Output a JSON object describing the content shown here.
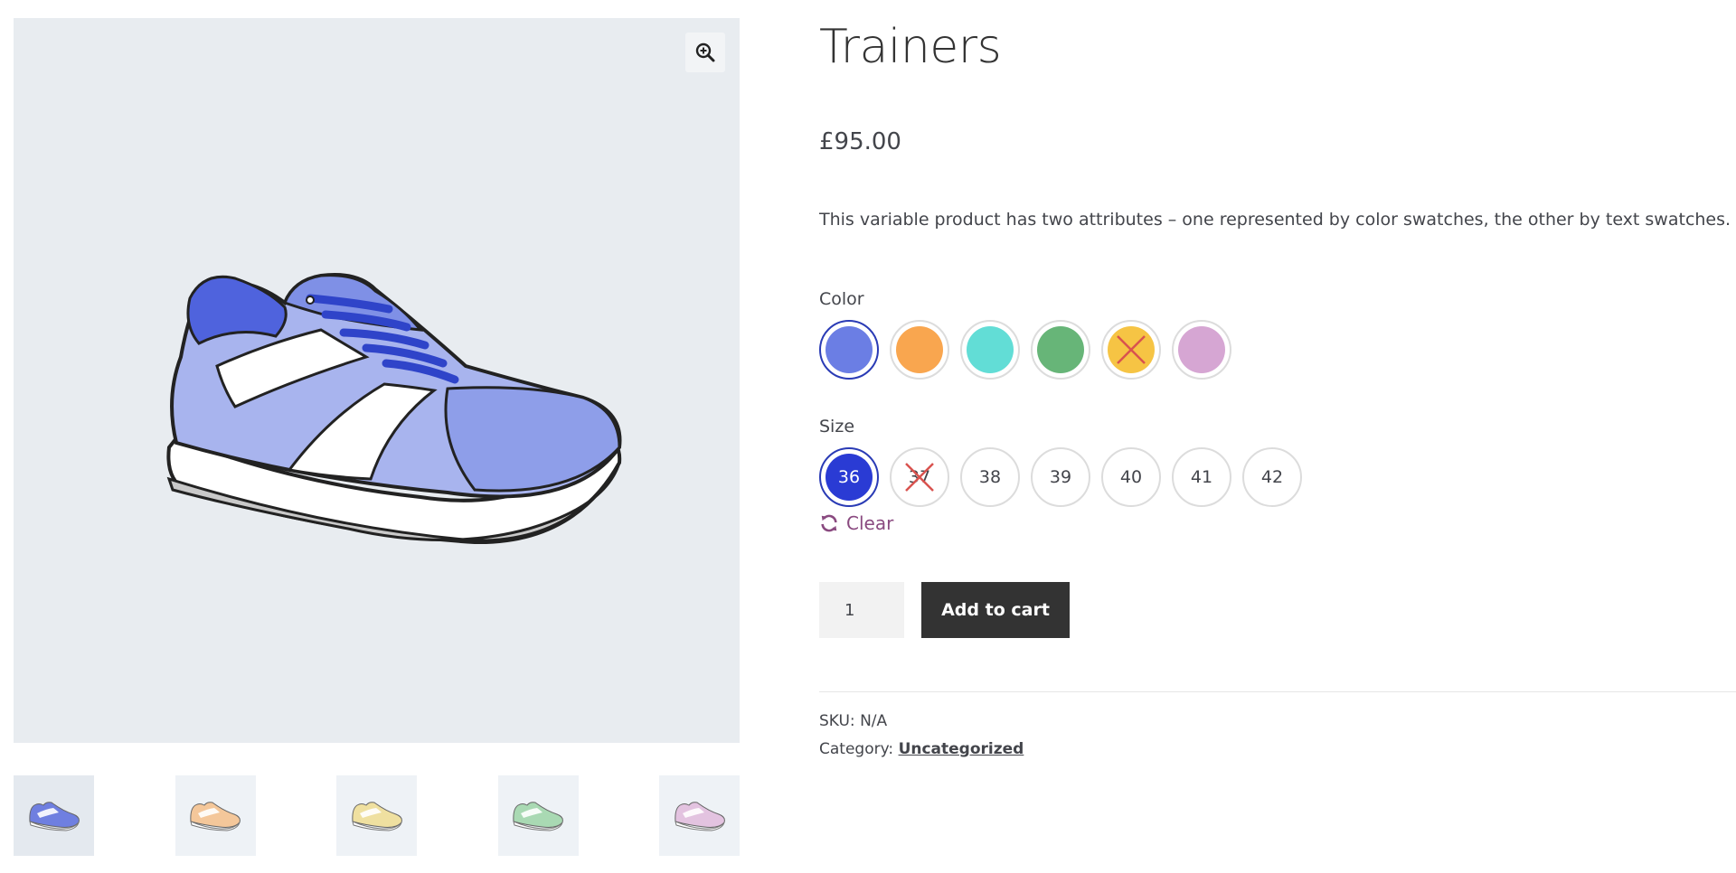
{
  "gallery": {
    "zoom_icon": "zoom-in-icon",
    "thumbnails": [
      {
        "color": "#6f7fe0",
        "active": true
      },
      {
        "color": "#f4c79a",
        "active": false
      },
      {
        "color": "#efe0a0",
        "active": false
      },
      {
        "color": "#a9d9b3",
        "active": false
      },
      {
        "color": "#e3c3e0",
        "active": false
      }
    ]
  },
  "product": {
    "title": "Trainers",
    "price": "£95.00",
    "description": "This variable product has two attributes – one represented by color swatches, the other by text swatches."
  },
  "color_attribute": {
    "label": "Color",
    "swatches": [
      {
        "color": "#6b7ee4",
        "selected": true,
        "disabled": false
      },
      {
        "color": "#f9a64f",
        "selected": false,
        "disabled": false
      },
      {
        "color": "#62ddd6",
        "selected": false,
        "disabled": false
      },
      {
        "color": "#67b578",
        "selected": false,
        "disabled": false
      },
      {
        "color": "#f6c444",
        "selected": false,
        "disabled": true
      },
      {
        "color": "#d6a6d3",
        "selected": false,
        "disabled": false
      }
    ]
  },
  "size_attribute": {
    "label": "Size",
    "swatches": [
      {
        "label": "36",
        "selected": true,
        "disabled": false
      },
      {
        "label": "37",
        "selected": false,
        "disabled": true
      },
      {
        "label": "38",
        "selected": false,
        "disabled": false
      },
      {
        "label": "39",
        "selected": false,
        "disabled": false
      },
      {
        "label": "40",
        "selected": false,
        "disabled": false
      },
      {
        "label": "41",
        "selected": false,
        "disabled": false
      },
      {
        "label": "42",
        "selected": false,
        "disabled": false
      }
    ]
  },
  "clear_label": "Clear",
  "clear_icon": "refresh-icon",
  "quantity": "1",
  "add_to_cart_label": "Add to cart",
  "meta": {
    "sku_label": "SKU:",
    "sku_value": "N/A",
    "category_label": "Category:",
    "category_value": "Uncategorized"
  },
  "colors": {
    "accent_selected": "#2a3bd4",
    "link_clear": "#8a4a80",
    "button_dark": "#333333",
    "disabled_cross": "#d9534f"
  }
}
